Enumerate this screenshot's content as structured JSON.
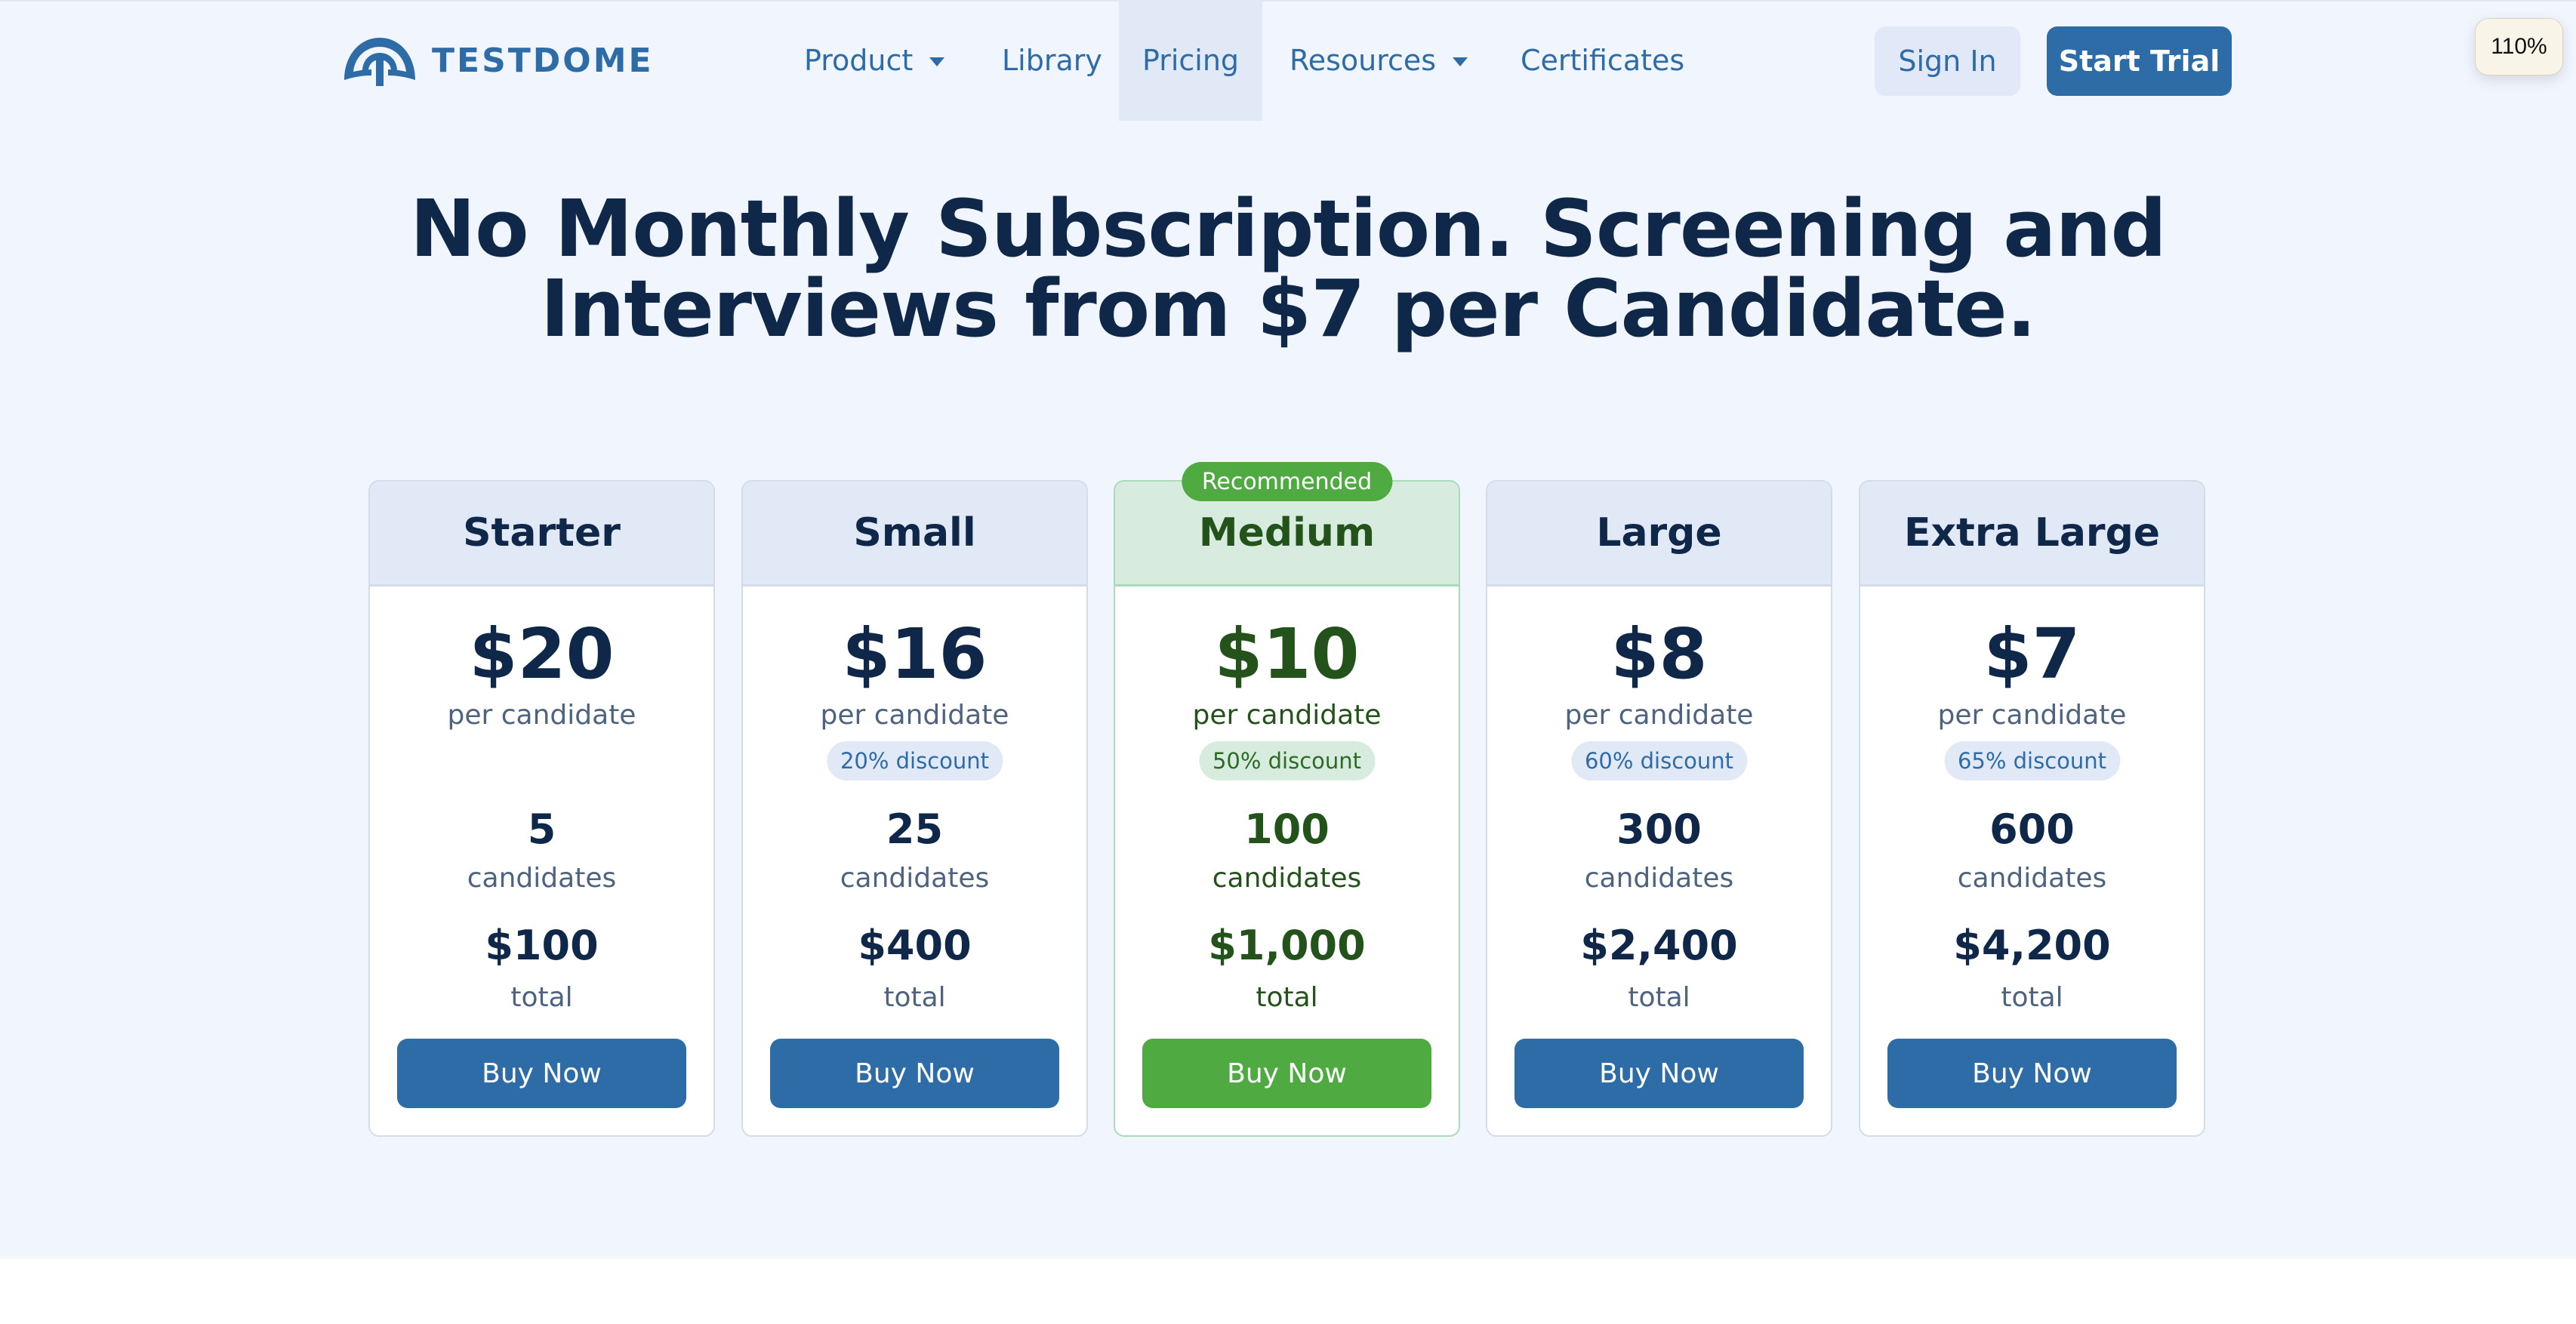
{
  "brand": {
    "name": "TESTDOME",
    "logo_icon": "dome-logo-icon",
    "accent": "#2e6ca7"
  },
  "nav": {
    "items": [
      {
        "label": "Product",
        "has_dropdown": true
      },
      {
        "label": "Library",
        "has_dropdown": false
      },
      {
        "label": "Pricing",
        "has_dropdown": false,
        "active": true
      },
      {
        "label": "Resources",
        "has_dropdown": true
      },
      {
        "label": "Certificates",
        "has_dropdown": false
      }
    ],
    "sign_in_label": "Sign In",
    "start_trial_label": "Start Trial"
  },
  "zoom_indicator": "110%",
  "headline": {
    "line1": "No Monthly Subscription. Screening and",
    "line2": "Interviews from $7 per Candidate."
  },
  "plans": [
    {
      "name": "Starter",
      "price": "$20",
      "per_label": "per candidate",
      "discount": "",
      "count": "5",
      "count_label": "candidates",
      "total": "$100",
      "total_label": "total",
      "button_label": "Buy Now",
      "recommended": false
    },
    {
      "name": "Small",
      "price": "$16",
      "per_label": "per candidate",
      "discount": "20% discount",
      "count": "25",
      "count_label": "candidates",
      "total": "$400",
      "total_label": "total",
      "button_label": "Buy Now",
      "recommended": false
    },
    {
      "name": "Medium",
      "price": "$10",
      "per_label": "per candidate",
      "discount": "50% discount",
      "count": "100",
      "count_label": "candidates",
      "total": "$1,000",
      "total_label": "total",
      "button_label": "Buy Now",
      "recommended": true,
      "badge": "Recommended"
    },
    {
      "name": "Large",
      "price": "$8",
      "per_label": "per candidate",
      "discount": "60% discount",
      "count": "300",
      "count_label": "candidates",
      "total": "$2,400",
      "total_label": "total",
      "button_label": "Buy Now",
      "recommended": false
    },
    {
      "name": "Extra Large",
      "price": "$7",
      "per_label": "per candidate",
      "discount": "65% discount",
      "count": "600",
      "count_label": "candidates",
      "total": "$4,200",
      "total_label": "total",
      "button_label": "Buy Now",
      "recommended": false
    }
  ],
  "colors": {
    "primary": "#2e6ca7",
    "recommended_green": "#4fab41",
    "dark_text": "#0f2749",
    "green_text": "#23531a",
    "page_bg": "#f1f5fd"
  }
}
